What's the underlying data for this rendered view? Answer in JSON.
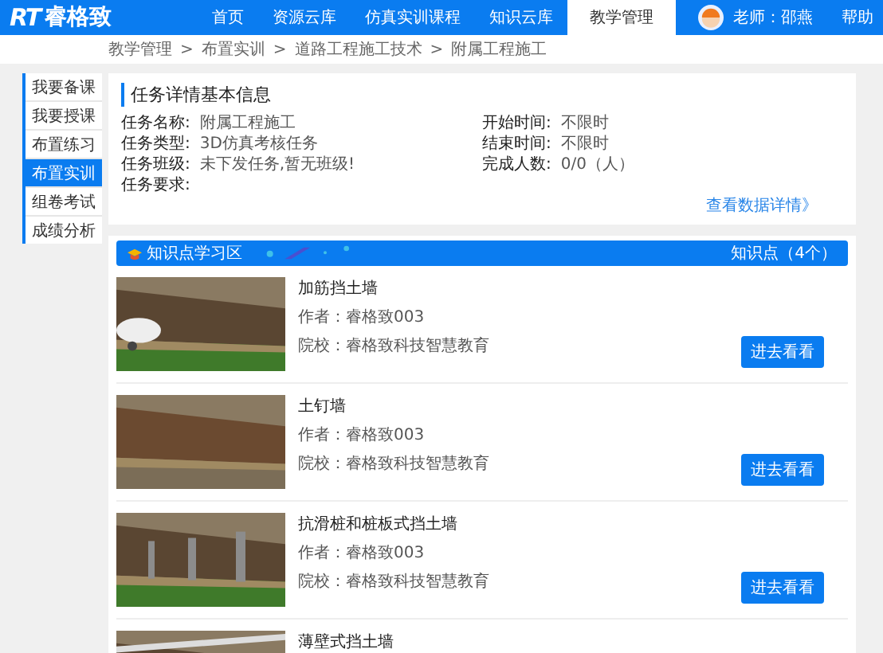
{
  "header": {
    "logo": {
      "mark": "RT",
      "name": "睿格致"
    },
    "nav": [
      {
        "label": "首页",
        "selected": false
      },
      {
        "label": "资源云库",
        "selected": false
      },
      {
        "label": "仿真实训课程",
        "selected": false
      },
      {
        "label": "知识云库",
        "selected": false
      },
      {
        "label": "教学管理",
        "selected": true
      }
    ],
    "user": "老师：邵燕",
    "help": "帮助"
  },
  "breadcrumb": [
    "教学管理",
    "布置实训",
    "道路工程施工技术",
    "附属工程施工"
  ],
  "breadcrumb_separator": ">",
  "sidebar": {
    "items": [
      {
        "label": "我要备课",
        "selected": false
      },
      {
        "label": "我要授课",
        "selected": false
      },
      {
        "label": "布置练习",
        "selected": false
      },
      {
        "label": "布置实训",
        "selected": true
      },
      {
        "label": "组卷考试",
        "selected": false
      },
      {
        "label": "成绩分析",
        "selected": false
      }
    ]
  },
  "task_info": {
    "title": "任务详情基本信息",
    "left": [
      {
        "label": "任务名称:",
        "value": "附属工程施工"
      },
      {
        "label": "任务类型:",
        "value": "3D仿真考核任务"
      },
      {
        "label": "任务班级:",
        "value": "未下发任务,暂无班级!"
      },
      {
        "label": "任务要求:"
      }
    ],
    "right": [
      {
        "label": "开始时间:",
        "value": "不限时"
      },
      {
        "label": "结束时间:",
        "value": "不限时"
      },
      {
        "label": "完成人数:",
        "value": "0/0（人）"
      }
    ],
    "link": "查看数据详情》"
  },
  "knowledge": {
    "title": "知识点学习区",
    "count": "知识点（4个）",
    "items": [
      {
        "title": "加筋挡土墙",
        "author": "作者：睿格致003",
        "school": "院校：睿格致科技智慧教育",
        "button": "进去看看"
      },
      {
        "title": "土钉墙",
        "author": "作者：睿格致003",
        "school": "院校：睿格致科技智慧教育",
        "button": "进去看看"
      },
      {
        "title": "抗滑桩和桩板式挡土墙",
        "author": "作者：睿格致003",
        "school": "院校：睿格致科技智慧教育",
        "button": "进去看看"
      },
      {
        "title": "薄壁式挡土墙"
      }
    ]
  }
}
